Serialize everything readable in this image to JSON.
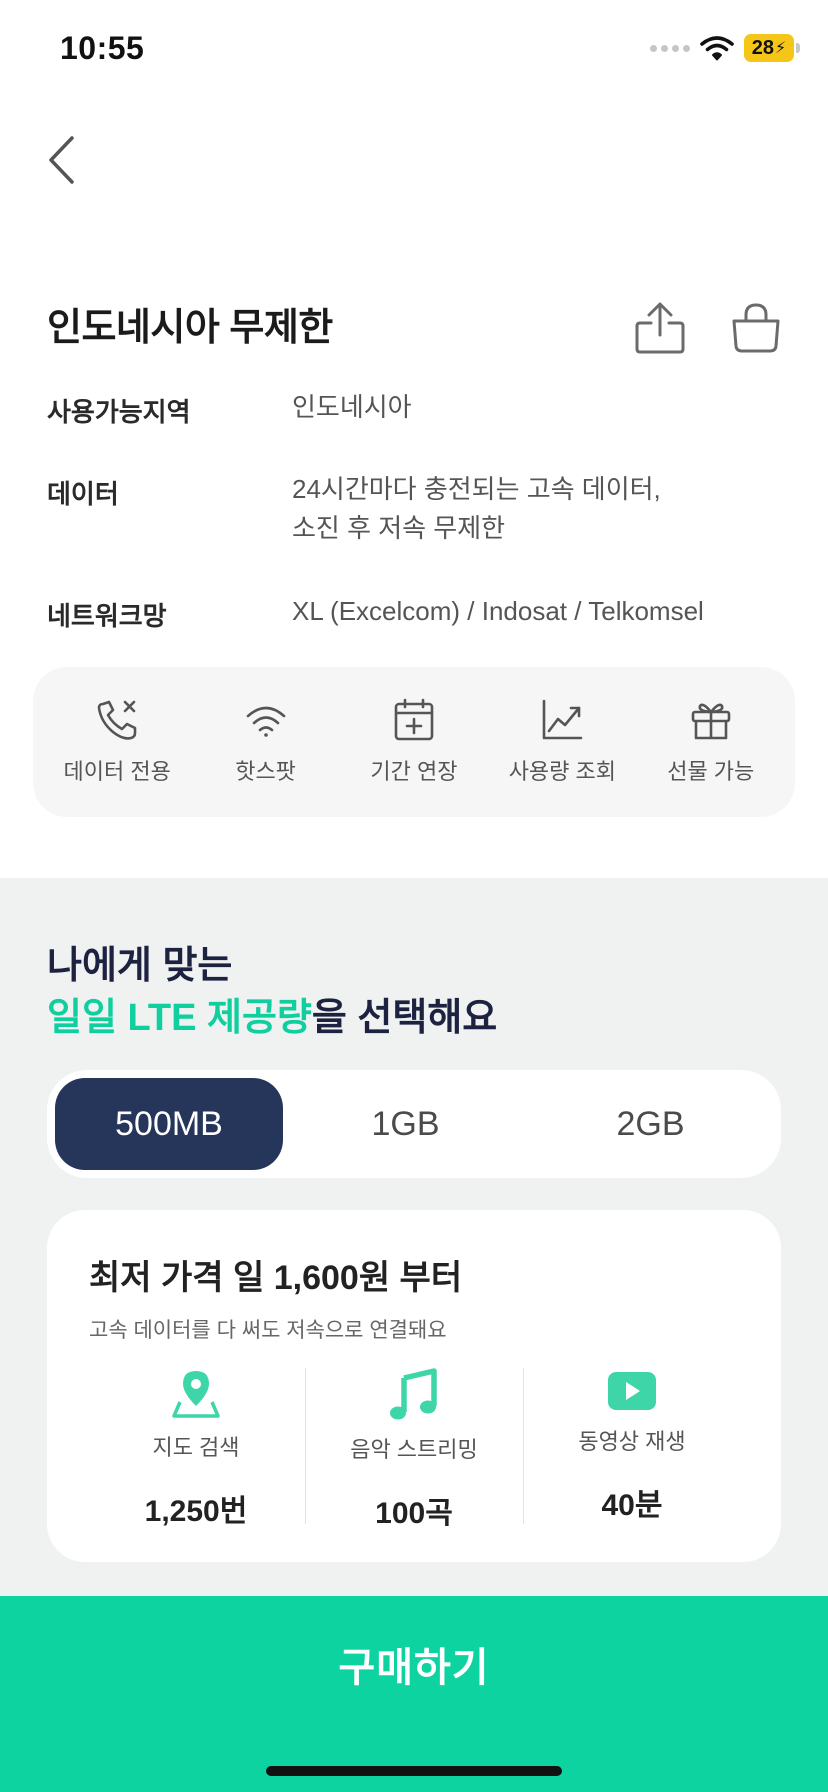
{
  "status_bar": {
    "time": "10:55",
    "battery": "28"
  },
  "header": {
    "back_icon": "chevron-left-icon",
    "share_icon": "share-icon",
    "cart_icon": "shopping-bag-icon"
  },
  "product": {
    "title": "인도네시아 무제한",
    "info": [
      {
        "label": "사용가능지역",
        "value": "인도네시아"
      },
      {
        "label": "데이터",
        "value_line1": "24시간마다 충전되는 고속 데이터,",
        "value_line2": "소진 후 저속 무제한"
      },
      {
        "label": "네트워크망",
        "value": "XL (Excelcom) / Indosat / Telkomsel"
      }
    ]
  },
  "features": [
    {
      "label": "데이터 전용",
      "icon": "no-call-icon"
    },
    {
      "label": "핫스팟",
      "icon": "wifi-icon"
    },
    {
      "label": "기간 연장",
      "icon": "calendar-plus-icon"
    },
    {
      "label": "사용량 조회",
      "icon": "chart-icon"
    },
    {
      "label": "선물 가능",
      "icon": "gift-icon"
    }
  ],
  "selector": {
    "headline_line1": "나에게 맞는",
    "headline_accent": "일일 LTE 제공량",
    "headline_rest": "을 선택해요",
    "accent_color": "#10cf9f",
    "options": [
      "500MB",
      "1GB",
      "2GB"
    ],
    "selected": "500MB"
  },
  "price_card": {
    "title": "최저 가격 일 1,600원 부터",
    "subtitle": "고속 데이터를 다 써도 저속으로 연결돼요",
    "usage": [
      {
        "label": "지도 검색",
        "value": "1,250번",
        "icon": "map-pin-icon"
      },
      {
        "label": "음악 스트리밍",
        "value": "100곡",
        "icon": "music-note-icon"
      },
      {
        "label": "동영상 재생",
        "value": "40분",
        "icon": "play-icon"
      }
    ]
  },
  "buy": {
    "label": "구매하기",
    "color": "#0cd3a0"
  }
}
